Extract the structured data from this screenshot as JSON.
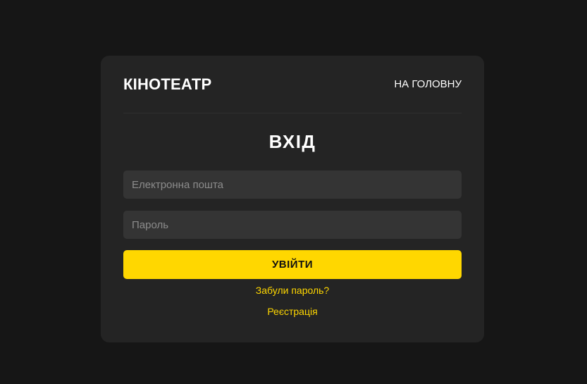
{
  "header": {
    "brand": "КІНОТЕАТР",
    "home_link": "НА ГОЛОВНУ"
  },
  "form": {
    "title": "ВХІД",
    "email": {
      "placeholder": "Електронна пошта",
      "value": ""
    },
    "password": {
      "placeholder": "Пароль",
      "value": ""
    },
    "submit_label": "УВІЙТИ",
    "forgot_label": "Забули пароль?",
    "register_label": "Реєстрація"
  },
  "colors": {
    "page_background": "#161616",
    "card_background": "#242424",
    "input_background": "#343434",
    "accent": "#ffd700",
    "text": "#ffffff"
  }
}
